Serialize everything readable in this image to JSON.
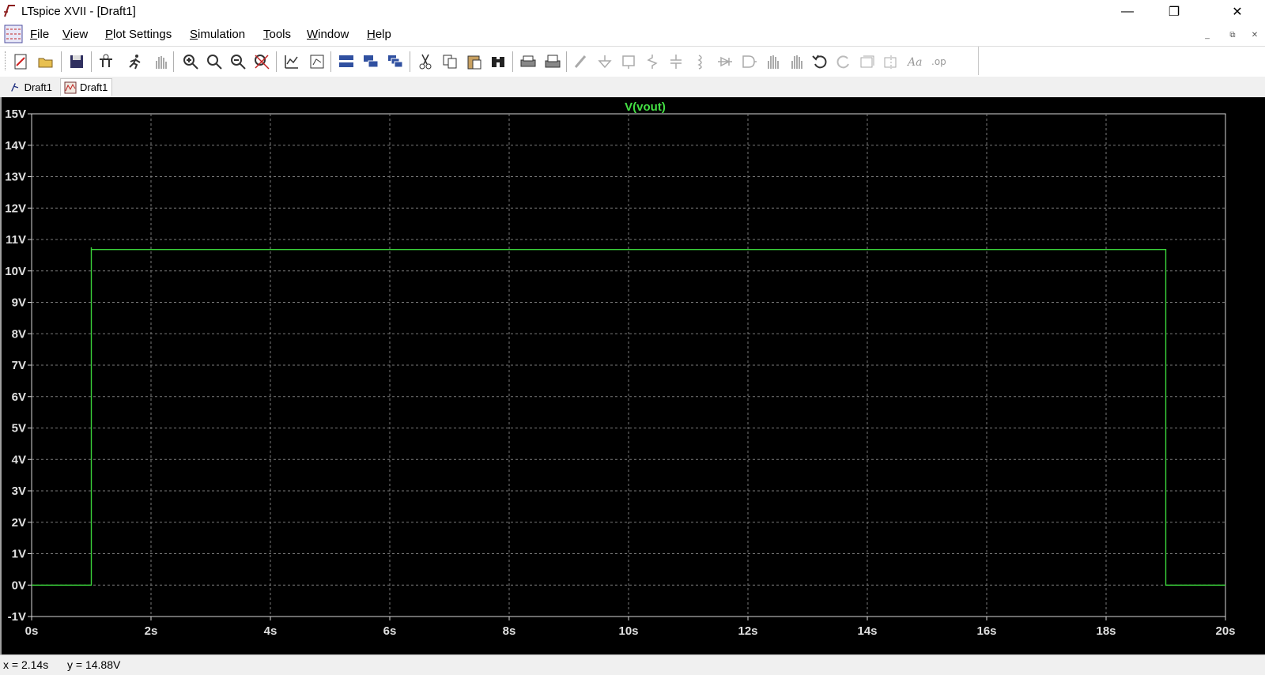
{
  "window": {
    "title": "LTspice XVII - [Draft1]",
    "controls": {
      "minimize": "—",
      "maximize": "❐",
      "close": "✕"
    }
  },
  "menu": [
    {
      "first": "F",
      "rest": "ile"
    },
    {
      "first": "V",
      "rest": "iew"
    },
    {
      "first": "P",
      "rest": "lot Settings"
    },
    {
      "first": "S",
      "rest": "imulation"
    },
    {
      "first": "T",
      "rest": "ools"
    },
    {
      "first": "W",
      "rest": "indow"
    },
    {
      "first": "H",
      "rest": "elp"
    }
  ],
  "mdi_controls": {
    "minimize": "_",
    "restore": "⧉",
    "close": "✕"
  },
  "tabs": [
    {
      "label": "Draft1",
      "icon": "schematic-icon",
      "active": false
    },
    {
      "label": "Draft1",
      "icon": "waveform-icon",
      "active": true
    }
  ],
  "toolbar": {
    "icons": [
      "new-schematic-icon",
      "open-icon",
      "save-icon",
      "control-panel-icon",
      "run-icon",
      "halt-icon",
      "zoom-area-icon",
      "zoom-in-icon",
      "zoom-out-icon",
      "zoom-fit-icon",
      "autorange-icon",
      "view-fit-icon",
      "tile-horizontal-icon",
      "tile-vertical-icon",
      "cascade-icon",
      "cut-icon",
      "copy-icon",
      "paste-icon",
      "find-icon",
      "print-icon",
      "print-setup-icon",
      "wire-icon",
      "ground-icon",
      "label-net-icon",
      "resistor-icon",
      "capacitor-icon",
      "inductor-icon",
      "diode-icon",
      "component-icon",
      "move-icon",
      "drag-icon",
      "undo-icon",
      "redo-icon",
      "rotate-icon",
      "mirror-icon",
      "text-icon",
      "spice-directive-icon"
    ]
  },
  "colors": {
    "plot_background": "#000000",
    "trace": "#3ad13a",
    "grid": "#7a7a7a",
    "axis_label": "#e0e0e0",
    "trace_label": "#44e044"
  },
  "chart_data": {
    "type": "line",
    "title": "V(vout)",
    "xlabel": "",
    "ylabel": "",
    "xlim": [
      0,
      20
    ],
    "ylim": [
      -1,
      15
    ],
    "x_ticks": [
      0,
      2,
      4,
      6,
      8,
      10,
      12,
      14,
      16,
      18,
      20
    ],
    "x_tick_labels": [
      "0s",
      "2s",
      "4s",
      "6s",
      "8s",
      "10s",
      "12s",
      "14s",
      "16s",
      "18s",
      "20s"
    ],
    "y_ticks": [
      15,
      14,
      13,
      12,
      11,
      10,
      9,
      8,
      7,
      6,
      5,
      4,
      3,
      2,
      1,
      0,
      -1
    ],
    "y_tick_labels": [
      "15V",
      "14V",
      "13V",
      "12V",
      "11V",
      "10V",
      "9V",
      "8V",
      "7V",
      "6V",
      "5V",
      "4V",
      "3V",
      "2V",
      "1V",
      "0V",
      "-1V"
    ],
    "grid": true,
    "series": [
      {
        "name": "V(vout)",
        "x": [
          0,
          1.0,
          1.0,
          1.0,
          1.02,
          19.0,
          19.0,
          20
        ],
        "y": [
          0,
          0,
          10.75,
          10.68,
          10.68,
          10.68,
          0,
          0
        ]
      }
    ]
  },
  "status": {
    "x_readout": "x = 2.14s",
    "y_readout": "y = 14.88V"
  }
}
